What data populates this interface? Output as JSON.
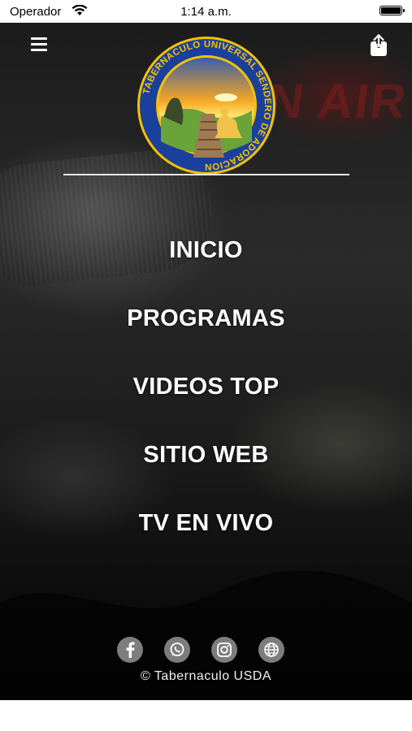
{
  "status_bar": {
    "carrier": "Operador",
    "time": "1:14 a.m."
  },
  "background": {
    "sign_text": "N AIR"
  },
  "logo": {
    "ring_text": "TABERNACULO UNIVERSAL SENDERO DE ADORACION",
    "ring_color": "#1b3f9c",
    "text_color": "#f2c200"
  },
  "nav": {
    "items": [
      "INICIO",
      "PROGRAMAS",
      "VIDEOS TOP",
      "SITIO WEB",
      "TV EN VIVO"
    ]
  },
  "social": {
    "icons": [
      "facebook-icon",
      "whatsapp-icon",
      "instagram-icon",
      "globe-icon"
    ]
  },
  "footer": {
    "copyright": "© Tabernaculo USDA"
  },
  "colors": {
    "text": "#ffffff",
    "social_bg": "#7d7d7d"
  }
}
